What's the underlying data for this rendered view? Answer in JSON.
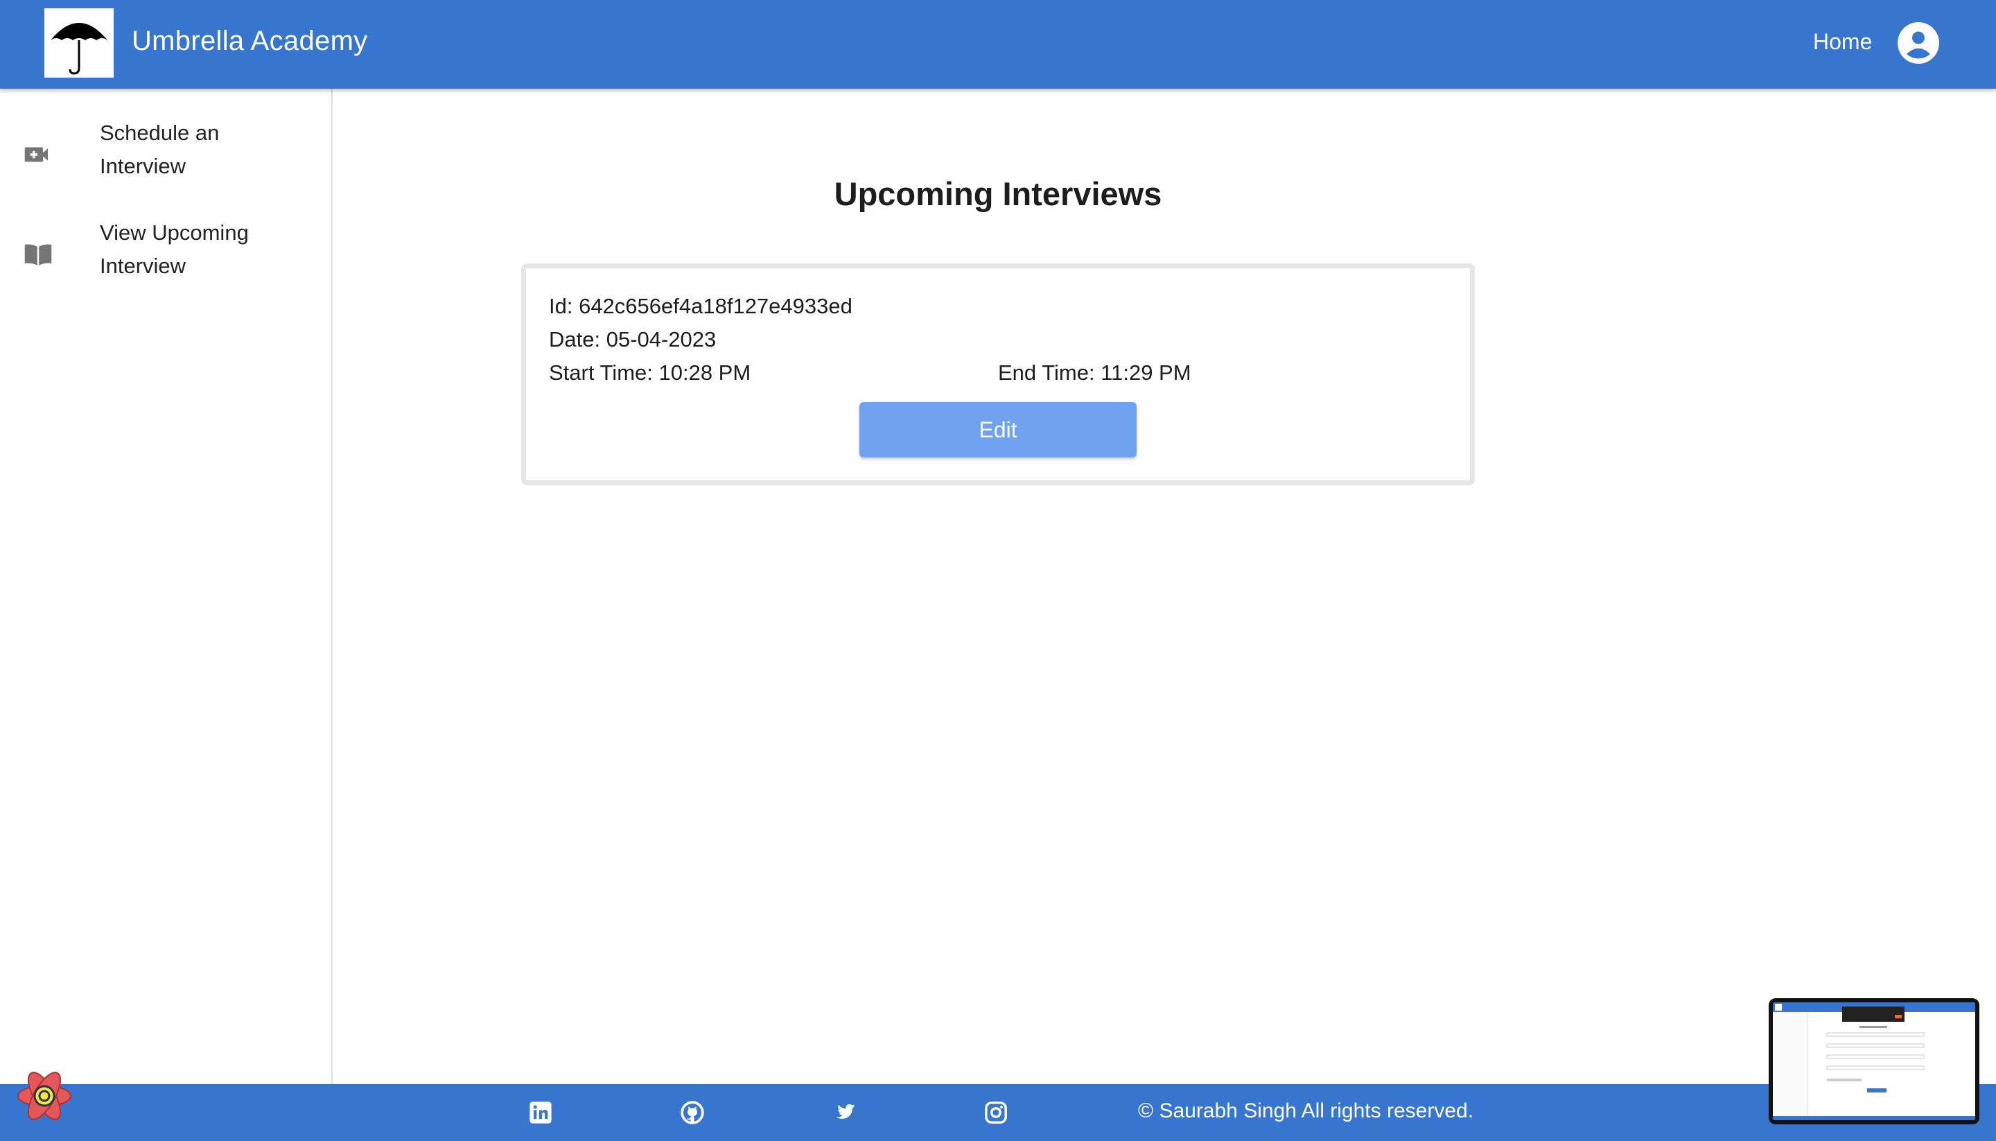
{
  "app": {
    "title": "Umbrella Academy",
    "logo_alt": "Umbrella Academy logo"
  },
  "header": {
    "home_label": "Home",
    "account_icon": "account-circle-icon"
  },
  "sidebar": {
    "items": [
      {
        "label": "Schedule an Interview",
        "icon": "video-plus-icon"
      },
      {
        "label": "View Upcoming Interview",
        "icon": "book-icon"
      }
    ]
  },
  "main": {
    "title": "Upcoming Interviews",
    "interviews": [
      {
        "id_text": "Id: 642c656ef4a18f127e4933ed",
        "date_text": "Date: 05-04-2023",
        "start_text": "Start Time: 10:28 PM",
        "end_text": "End Time: 11:29 PM",
        "edit_label": "Edit"
      }
    ]
  },
  "footer": {
    "icons": [
      "linkedin-icon",
      "github-icon",
      "twitter-icon",
      "instagram-icon"
    ],
    "copyright": "© Saurabh Singh All rights reserved."
  },
  "colors": {
    "primary": "#3875cf",
    "button": "#6fa3f1",
    "card_border": "#e6e6e6"
  }
}
